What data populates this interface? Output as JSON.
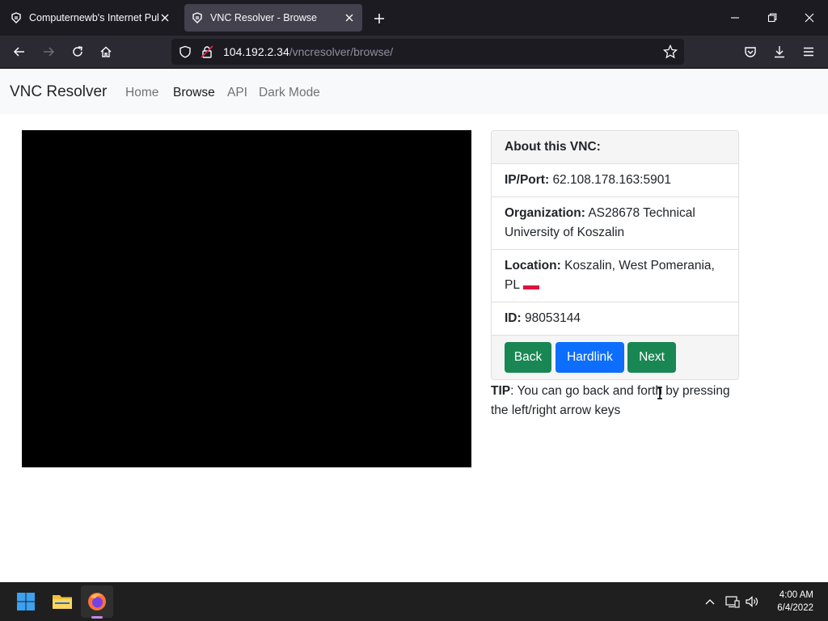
{
  "browser": {
    "tabs": [
      {
        "title": "Computernewb's Internet Pub H",
        "active": false
      },
      {
        "title": "VNC Resolver - Browse",
        "active": true
      }
    ],
    "url_host": "104.192.2.34",
    "url_path": "/vncresolver/browse/"
  },
  "site": {
    "brand": "VNC Resolver",
    "nav": [
      "Home",
      "Browse",
      "API",
      "Dark Mode"
    ],
    "active_nav": "Browse"
  },
  "card": {
    "header": "About this VNC:",
    "ip_label": "IP/Port:",
    "ip_value": "62.108.178.163:5901",
    "org_label": "Organization:",
    "org_value": "AS28678 Technical University of Koszalin",
    "loc_label": "Location:",
    "loc_value": "Koszalin, West Pomerania, PL",
    "country_flag": "PL",
    "id_label": "ID:",
    "id_value": "98053144",
    "buttons": {
      "back": "Back",
      "hardlink": "Hardlink",
      "next": "Next"
    }
  },
  "tip": {
    "label": "TIP",
    "text": ": You can go back and forth by pressing the left/right arrow keys"
  },
  "taskbar": {
    "time": "4:00 AM",
    "date": "6/4/2022"
  },
  "colors": {
    "green_button": "#198754",
    "blue_button": "#0d6efd",
    "vnc_screen": "#000000",
    "browser_chrome": "#1c1b22"
  }
}
